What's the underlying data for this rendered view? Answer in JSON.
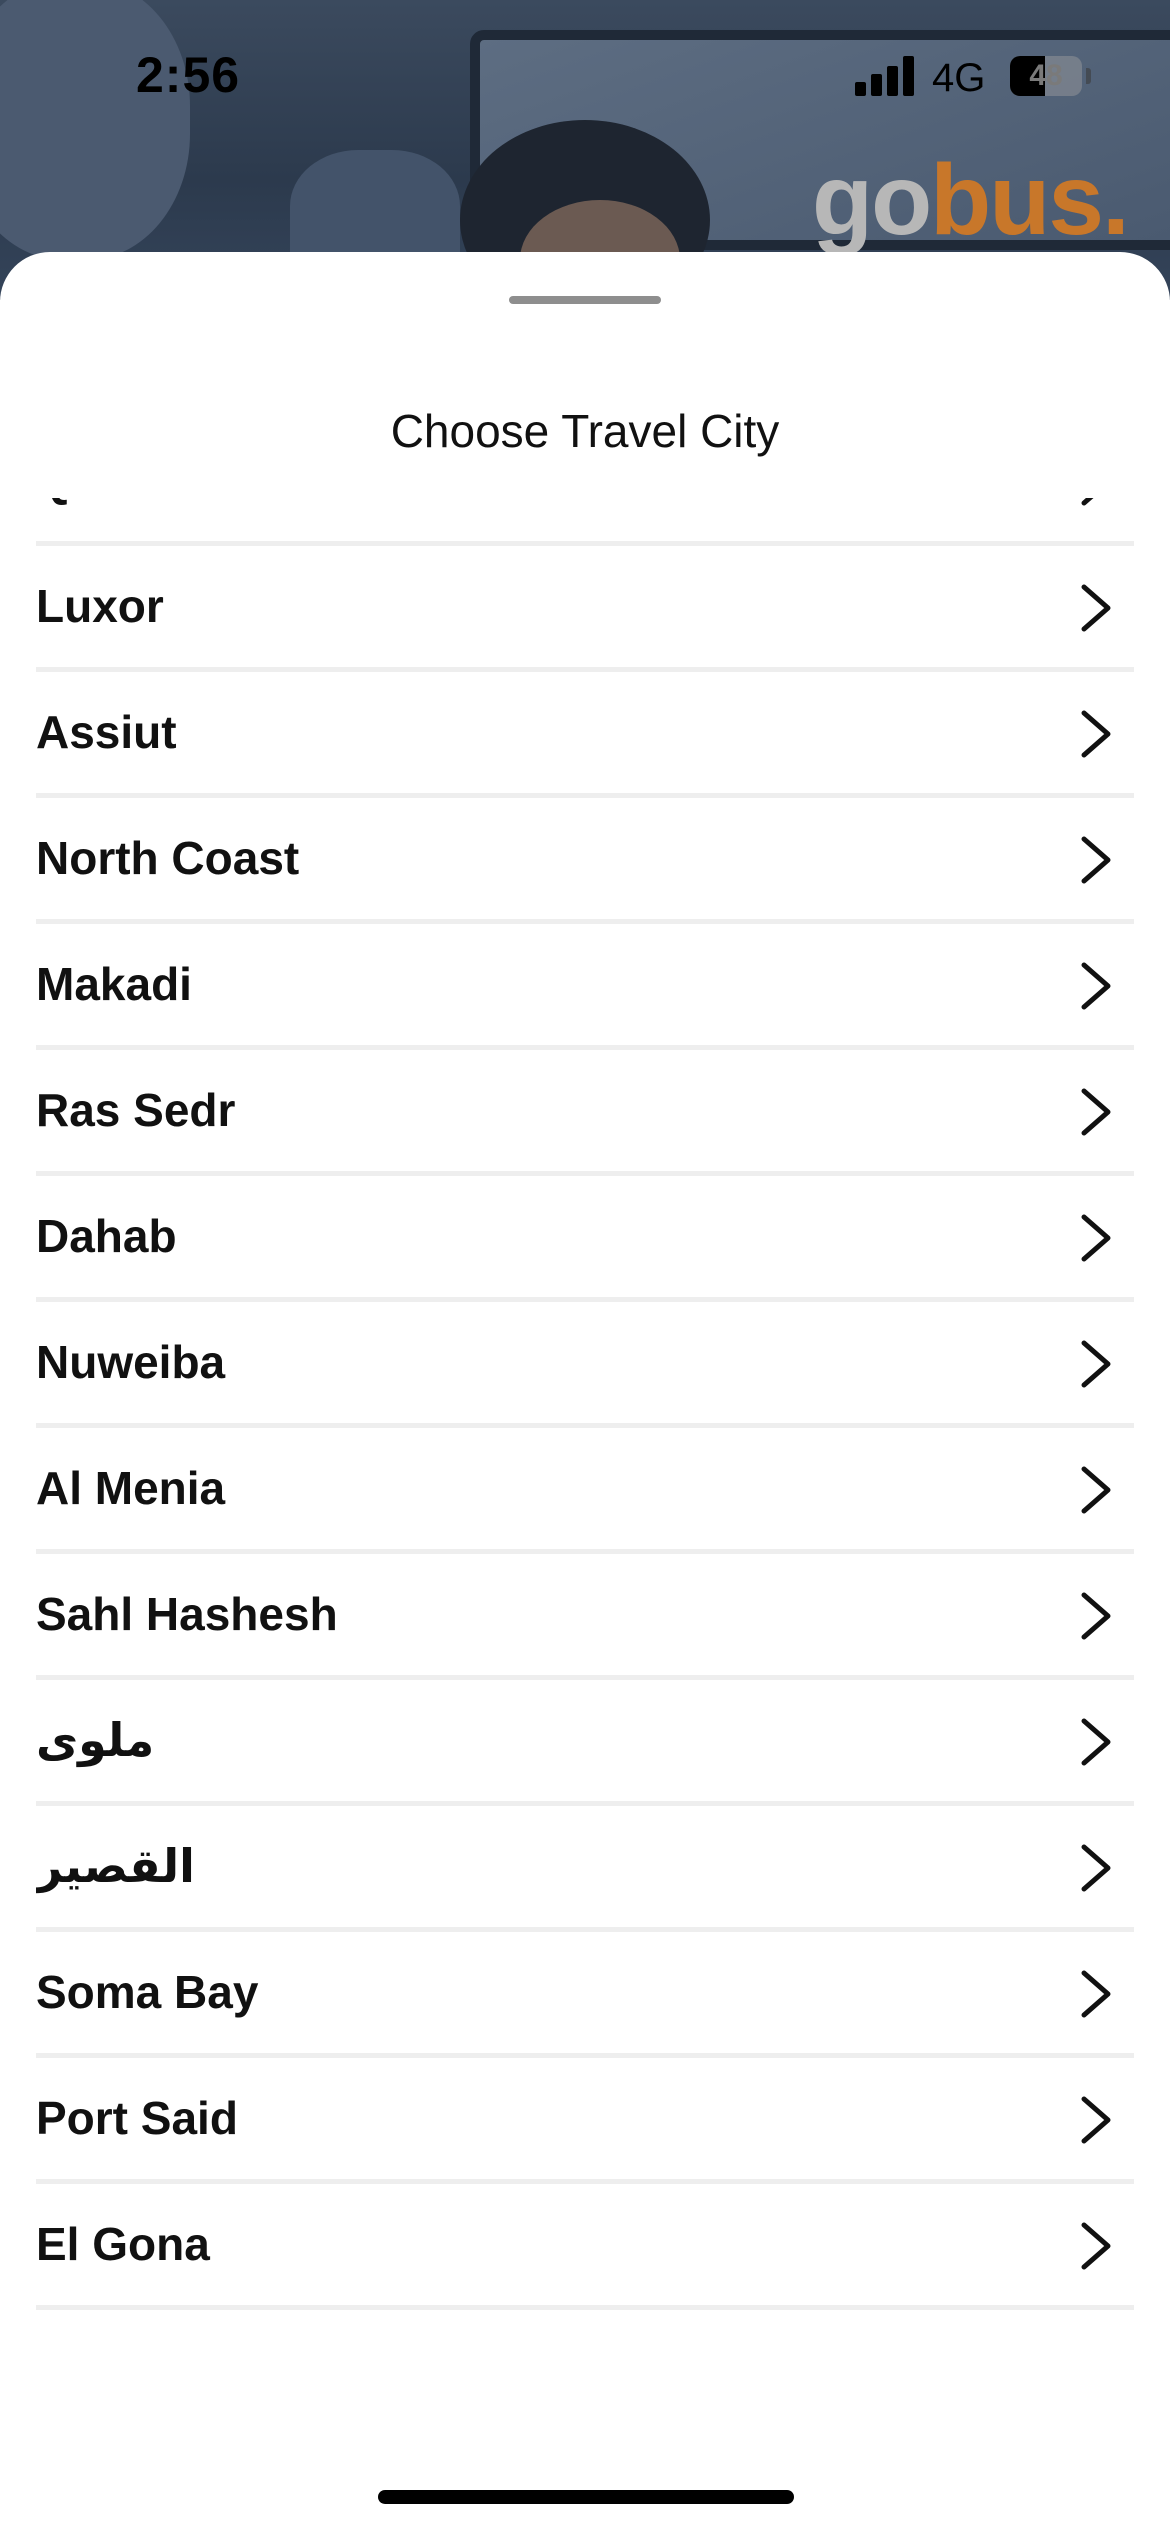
{
  "status_bar": {
    "time": "2:56",
    "network": "4G",
    "battery_level": "48",
    "battery_fraction": 0.48
  },
  "logo": {
    "part_go": "go",
    "part_bus": "bus."
  },
  "sheet": {
    "title": "Choose Travel City"
  },
  "cities": [
    "Qena",
    "Luxor",
    "Assiut",
    "North Coast",
    "Makadi",
    "Ras Sedr",
    "Dahab",
    "Nuweiba",
    "Al Menia",
    "Sahl Hashesh",
    "ملوى",
    "القصير",
    "Soma Bay",
    "Port Said",
    "El Gona"
  ],
  "icons": {
    "row_chevron": "chevron-right-icon"
  },
  "colors": {
    "logo_go": "#b7b7b7",
    "logo_bus": "#c8772a",
    "divider": "#eeeeee",
    "text": "#111111"
  }
}
